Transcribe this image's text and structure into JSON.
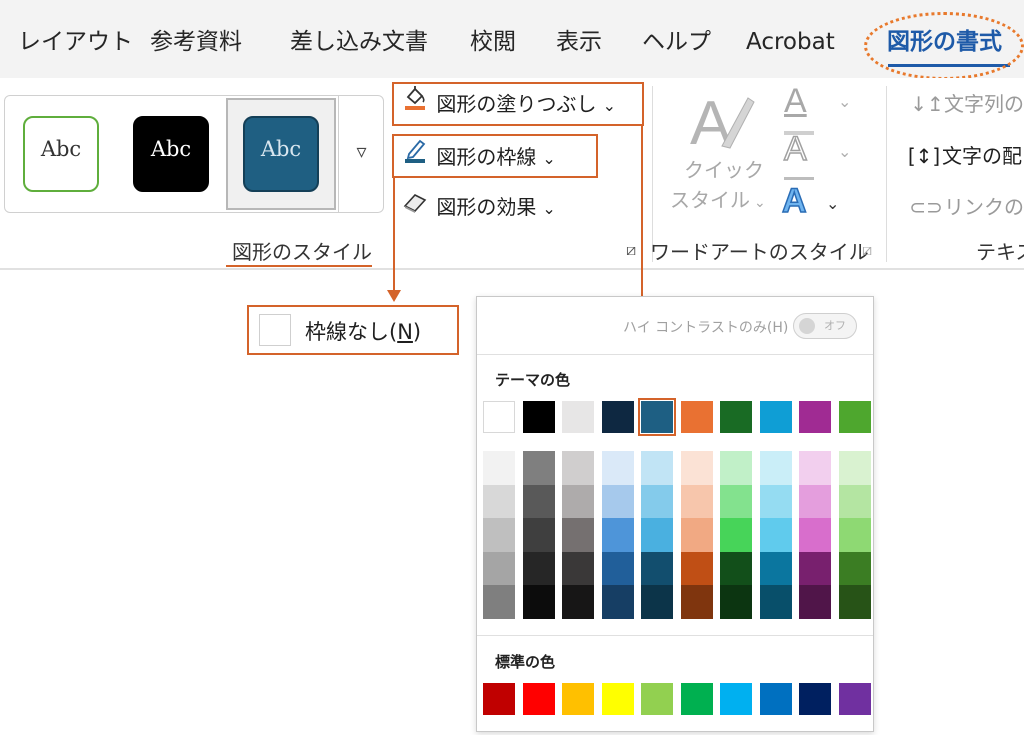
{
  "tabs": [
    {
      "label": "レイアウト",
      "active": false
    },
    {
      "label": "参考資料",
      "active": false
    },
    {
      "label": "差し込み文書",
      "active": false
    },
    {
      "label": "校閲",
      "active": false
    },
    {
      "label": "表示",
      "active": false
    },
    {
      "label": "ヘルプ",
      "active": false
    },
    {
      "label": "Acrobat",
      "active": false
    },
    {
      "label": "図形の書式",
      "active": true
    }
  ],
  "shape_styles": {
    "swatches": [
      {
        "label": "Abc",
        "fill": "#ffffff",
        "border": "#5fae3c",
        "text_color": "#333333"
      },
      {
        "label": "Abc",
        "fill": "#000000",
        "border": "#000000",
        "text_color": "#ffffff"
      },
      {
        "label": "Abc",
        "fill": "#1f5f82",
        "border": "#143f57",
        "text_color": "#d8e6ef"
      }
    ],
    "more_glyph": "▿",
    "group_label": "図形のスタイル"
  },
  "shape_commands": {
    "fill": "図形の塗りつぶし",
    "outline": "図形の枠線",
    "effects": "図形の効果"
  },
  "wordart": {
    "quick_style_line1": "クイック",
    "quick_style_line2": "スタイル",
    "letter": "A",
    "group_label": "ワードアートのスタイル"
  },
  "text_group": {
    "direction": "文字列の",
    "align": "文字の配",
    "link": "リンクの作",
    "group_label": "テキス"
  },
  "no_outline": {
    "label_prefix": "枠線なし(",
    "accelerator": "N",
    "label_suffix": ")"
  },
  "color_panel": {
    "high_contrast_label": "ハイ コントラストのみ(H)",
    "toggle_label": "オフ",
    "theme_title": "テーマの色",
    "standard_title": "標準の色",
    "theme_top": [
      "#ffffff",
      "#000000",
      "#e7e6e6",
      "#0e2841",
      "#1e5f83",
      "#e97132",
      "#196b24",
      "#0f9ed5",
      "#a02b93",
      "#4ea72e"
    ],
    "theme_shades": [
      [
        "#f2f2f2",
        "#d8d8d8",
        "#bfbfbf",
        "#a5a5a5",
        "#7f7f7f"
      ],
      [
        "#7f7f7f",
        "#595959",
        "#3f3f3f",
        "#262626",
        "#0c0c0c"
      ],
      [
        "#d0cece",
        "#aeabab",
        "#757070",
        "#3a3838",
        "#171616"
      ],
      [
        "#dae9f8",
        "#a6c9ec",
        "#4e95d9",
        "#215f9a",
        "#163e64"
      ],
      [
        "#c1e4f5",
        "#84cbeb",
        "#4ab0e0",
        "#124e6e",
        "#0c3449"
      ],
      [
        "#fbe2d5",
        "#f7c6ac",
        "#f1a983",
        "#c04f15",
        "#7f350e"
      ],
      [
        "#c1f0c8",
        "#83e28e",
        "#47d459",
        "#124f1a",
        "#0c3511"
      ],
      [
        "#caeef8",
        "#95dcf2",
        "#60cbed",
        "#0b769f",
        "#084f6a"
      ],
      [
        "#f2cfee",
        "#e49edd",
        "#d86ecc",
        "#78206e",
        "#501549"
      ],
      [
        "#d9f2d0",
        "#b4e5a2",
        "#8ed973",
        "#3b7d23",
        "#275317"
      ]
    ],
    "standard": [
      "#c00000",
      "#ff0000",
      "#ffc000",
      "#ffff00",
      "#92d050",
      "#00b050",
      "#00b0f0",
      "#0070c0",
      "#002060",
      "#7030a0"
    ],
    "selected_index": 4
  }
}
